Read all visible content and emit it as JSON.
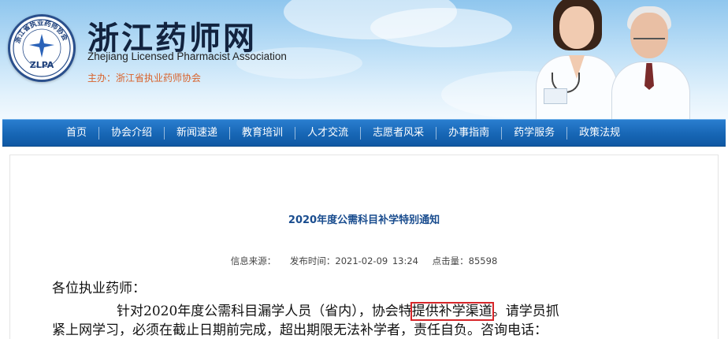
{
  "header": {
    "site_title": "浙江药师网",
    "site_subtitle": "Zhejiang Licensed Pharmacist Association",
    "sponsor": "主办：浙江省执业药师协会",
    "logo_ring_text": "浙江省执业药师协会",
    "logo_abbr": "ZLPA"
  },
  "nav": {
    "items": [
      "首页",
      "协会介绍",
      "新闻速递",
      "教育培训",
      "人才交流",
      "志愿者风采",
      "办事指南",
      "药学服务",
      "政策法规"
    ]
  },
  "article": {
    "title": "2020年度公需科目补学特别通知",
    "meta": {
      "source_label": "信息来源：",
      "publish_label": "发布时间：2021-02-09 13:24",
      "hits_label": "点击量：85598"
    },
    "greeting": "各位执业药师：",
    "para1_before": "针对2020年度公需科目漏学人员（省内），协会特",
    "para1_highlight": "提供补学渠道",
    "para1_after": "。请学员抓",
    "para2": "紧上网学习，必须在截止日期前完成，超出期限无法补学者，责任自负。咨询电话："
  },
  "colors": {
    "nav_blue": "#1766b5",
    "title_blue": "#1a4d8f",
    "sponsor_orange": "#d9622b",
    "highlight_red": "#d7262a"
  }
}
